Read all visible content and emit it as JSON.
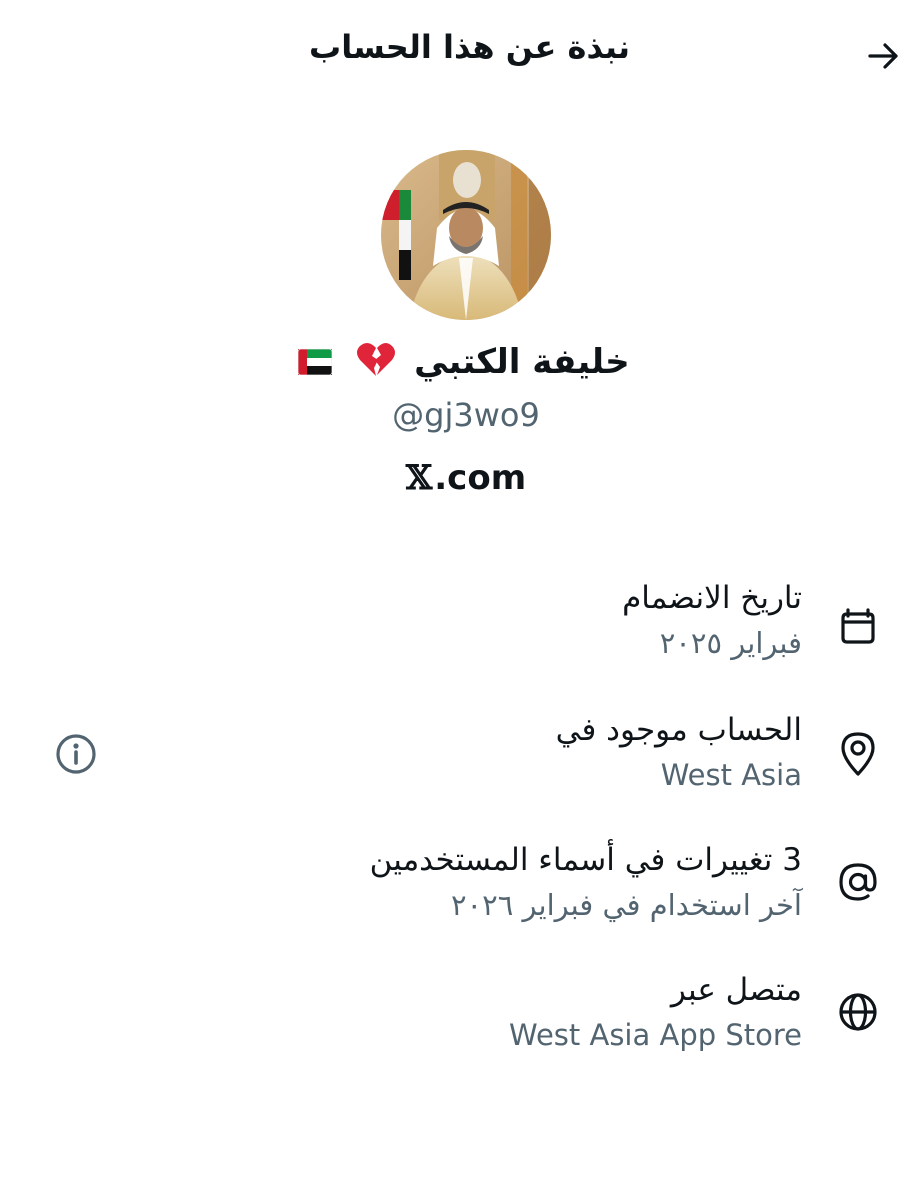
{
  "header": {
    "title": "نبذة عن هذا الحساب",
    "back_icon": "arrow-right-icon"
  },
  "profile": {
    "avatar_icon": "profile-photo",
    "display_name": "خليفة الكتبي",
    "name_emojis": [
      "💔",
      "🇦🇪"
    ],
    "handle": "@gj3wo9",
    "site_prefix": "𝕏",
    "site_suffix": ".com"
  },
  "details": [
    {
      "icon": "calendar-icon",
      "label": "تاريخ الانضمام",
      "value": "فبراير ٢٠٢٥"
    },
    {
      "icon": "location-pin-icon",
      "label": "الحساب موجود في",
      "value": "West Asia",
      "info_icon": "info-icon"
    },
    {
      "icon": "at-sign-icon",
      "label": "3 تغييرات في أسماء المستخدمين",
      "value": "آخر استخدام في فبراير ٢٠٢٦"
    },
    {
      "icon": "globe-icon",
      "label": "متصل عبر",
      "value": "West Asia App Store"
    }
  ],
  "colors": {
    "primary_text": "#0f1419",
    "secondary_text": "#536471"
  }
}
